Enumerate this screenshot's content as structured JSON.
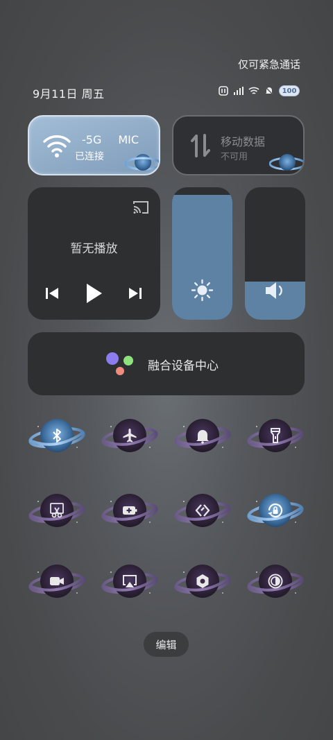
{
  "header": {
    "emergency_text": "仅可紧急通话",
    "date_text": "9月11日 周五",
    "battery": "100"
  },
  "tiles": {
    "wifi": {
      "name": "-5G",
      "name_suffix": "MIC",
      "status": "已连接",
      "active": true
    },
    "mobile": {
      "name": "移动数据",
      "status": "不可用",
      "active": false
    }
  },
  "media": {
    "title": "暂无播放"
  },
  "sliders": {
    "brightness": 0.94,
    "volume": 0.29
  },
  "device_center": {
    "label": "融合设备中心"
  },
  "toggles": [
    {
      "name": "bluetooth",
      "icon": "bluetooth-icon",
      "active": true
    },
    {
      "name": "airplane",
      "icon": "airplane-icon",
      "active": false
    },
    {
      "name": "bell",
      "icon": "bell-icon",
      "active": false
    },
    {
      "name": "flashlight",
      "icon": "flashlight-icon",
      "active": false
    },
    {
      "name": "screenshot",
      "icon": "screenshot-scissors-icon",
      "active": false
    },
    {
      "name": "battery-saver",
      "icon": "battery-saver-icon",
      "active": false
    },
    {
      "name": "share",
      "icon": "share-icon",
      "active": false
    },
    {
      "name": "auto-rotate",
      "icon": "rotation-lock-icon",
      "active": true
    },
    {
      "name": "screen-record",
      "icon": "video-camera-icon",
      "active": false
    },
    {
      "name": "screen-cast",
      "icon": "screen-cast-icon",
      "active": false
    },
    {
      "name": "settings",
      "icon": "hexagon-settings-icon",
      "active": false
    },
    {
      "name": "dark-mode",
      "icon": "dark-mode-icon",
      "active": false
    }
  ],
  "edit_label": "编辑",
  "colors": {
    "accent": "#5e82a3",
    "tile_dark": "#2e2f31",
    "planet_purple": "#3b2a4a",
    "planet_blue": "#5f8ec0"
  }
}
